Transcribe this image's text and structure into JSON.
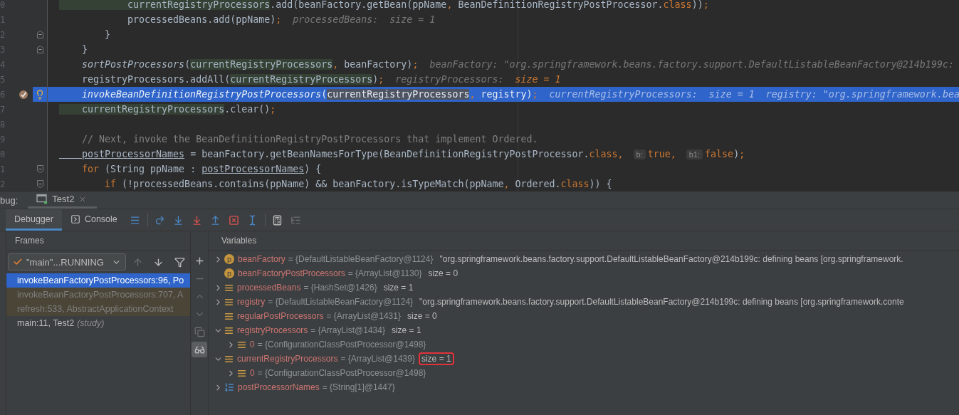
{
  "editor": {
    "lines": [
      {
        "number": "0",
        "current": false,
        "breakpoint": false,
        "bulb": false,
        "kind": "plain",
        "tokens": [
          {
            "kind": "var",
            "text": "            currentRegistryProcessors"
          },
          {
            "kind": "plain",
            "text": ".add(beanFactory.getBean(ppName"
          },
          {
            "kind": "kw",
            "text": ", "
          },
          {
            "kind": "plain",
            "text": "BeanDefinitionRegistryPostProcessor."
          },
          {
            "kind": "kw",
            "text": "class"
          },
          {
            "kind": "plain",
            "text": "))"
          },
          {
            "kind": "kw",
            "text": ";"
          }
        ]
      },
      {
        "number": "1",
        "current": false,
        "breakpoint": false,
        "bulb": false,
        "kind": "plain",
        "tokens": [
          {
            "kind": "plain",
            "text": "            processedBeans.add(ppName)"
          },
          {
            "kind": "kw",
            "text": ";"
          },
          {
            "kind": "hint",
            "text": "  processedBeans:  size = 1"
          }
        ]
      },
      {
        "number": "2",
        "current": false,
        "breakpoint": false,
        "bulb": false,
        "kind": "fold-end",
        "tokens": [
          {
            "kind": "plain",
            "text": "        }"
          }
        ]
      },
      {
        "number": "3",
        "current": false,
        "breakpoint": false,
        "bulb": false,
        "kind": "fold-end",
        "tokens": [
          {
            "kind": "plain",
            "text": "    }"
          }
        ]
      },
      {
        "number": "4",
        "current": false,
        "breakpoint": false,
        "bulb": false,
        "kind": "plain",
        "tokens": [
          {
            "kind": "method",
            "text": "    sortPostProcessors"
          },
          {
            "kind": "plain",
            "text": "("
          },
          {
            "kind": "var",
            "text": "currentRegistryProcessors"
          },
          {
            "kind": "kw",
            "text": ", "
          },
          {
            "kind": "plain",
            "text": "beanFactory)"
          },
          {
            "kind": "kw",
            "text": ";"
          },
          {
            "kind": "hint",
            "text": "  beanFactory: \"org.springframework.beans.factory.support.DefaultListableBeanFactory@214b199c:"
          }
        ]
      },
      {
        "number": "5",
        "current": false,
        "breakpoint": false,
        "bulb": false,
        "kind": "plain",
        "tokens": [
          {
            "kind": "plain",
            "text": "    registryProcessors.addAll("
          },
          {
            "kind": "var",
            "text": "currentRegistryProcessors"
          },
          {
            "kind": "plain",
            "text": ")"
          },
          {
            "kind": "kw",
            "text": ";"
          },
          {
            "kind": "hint",
            "text": "  registryProcessors:  "
          },
          {
            "kind": "hint-value",
            "text": "size = 1"
          }
        ]
      },
      {
        "number": "6",
        "current": true,
        "breakpoint": true,
        "bulb": true,
        "kind": "plain",
        "tokens": [
          {
            "kind": "method",
            "text": "    invokeBeanDefinitionRegistryPostProcessors"
          },
          {
            "kind": "plain",
            "text": "("
          },
          {
            "kind": "var",
            "text": "currentRegistryProcessors"
          },
          {
            "kind": "kw",
            "text": ", "
          },
          {
            "kind": "plain",
            "text": "registry)"
          },
          {
            "kind": "kw",
            "text": ";"
          },
          {
            "kind": "hint",
            "text": "  currentRegistryProcessors:  size = 1  registry: \"org.springframework.bea"
          }
        ]
      },
      {
        "number": "7",
        "current": false,
        "breakpoint": false,
        "bulb": false,
        "kind": "plain",
        "tokens": [
          {
            "kind": "var",
            "text": "    currentRegistryProcessors"
          },
          {
            "kind": "plain",
            "text": ".clear()"
          },
          {
            "kind": "kw",
            "text": ";"
          }
        ]
      },
      {
        "number": "8",
        "current": false,
        "breakpoint": false,
        "bulb": false,
        "kind": "plain"
      },
      {
        "number": "9",
        "current": false,
        "breakpoint": false,
        "bulb": false,
        "kind": "plain",
        "tokens": [
          {
            "kind": "comment",
            "text": "    // Next, invoke the BeanDefinitionRegistryPostProcessors that implement Ordered."
          }
        ]
      },
      {
        "number": "0",
        "current": false,
        "breakpoint": false,
        "bulb": false,
        "kind": "plain",
        "tokens": [
          {
            "kind": "field",
            "text": "    postProcessorNames"
          },
          {
            "kind": "plain",
            "text": " = beanFactory.getBeanNamesForType(BeanDefinitionRegistryPostProcessor."
          },
          {
            "kind": "kw",
            "text": "class, "
          },
          {
            "kind": "param",
            "text": "b:"
          },
          {
            "kind": "kw",
            "text": "true, "
          },
          {
            "kind": "param",
            "text": "b1:"
          },
          {
            "kind": "kw",
            "text": "false"
          },
          {
            "kind": "plain",
            "text": ")"
          },
          {
            "kind": "kw",
            "text": ";"
          }
        ]
      },
      {
        "number": "1",
        "current": false,
        "breakpoint": false,
        "bulb": false,
        "kind": "fold-start",
        "tokens": [
          {
            "kind": "kw",
            "text": "    for "
          },
          {
            "kind": "plain",
            "text": "(String ppName : "
          },
          {
            "kind": "field",
            "text": "postProcessorNames"
          },
          {
            "kind": "plain",
            "text": ") {"
          }
        ]
      },
      {
        "number": "2",
        "current": false,
        "breakpoint": false,
        "bulb": false,
        "kind": "fold-start",
        "tokens": [
          {
            "kind": "kw",
            "text": "        if "
          },
          {
            "kind": "plain",
            "text": "(!processedBeans.contains(ppName) && beanFactory.isTypeMatch(ppName"
          },
          {
            "kind": "kw",
            "text": ", "
          },
          {
            "kind": "plain",
            "text": "Ordered."
          },
          {
            "kind": "kw",
            "text": "class"
          },
          {
            "kind": "plain",
            "text": ")) {"
          }
        ]
      }
    ]
  },
  "debug": {
    "label": "bug:",
    "session": {
      "title": "Test2"
    },
    "tabs": [
      {
        "label": "Debugger",
        "kind": "plain",
        "selected": true
      },
      {
        "label": "Console",
        "kind": "console",
        "selected": false
      }
    ],
    "toolbar": [
      {
        "kind": "menu",
        "disabled": false
      },
      {
        "kind": "separator"
      },
      {
        "kind": "step-over",
        "disabled": false
      },
      {
        "kind": "step-into",
        "disabled": false
      },
      {
        "kind": "force-step-into",
        "disabled": false
      },
      {
        "kind": "step-out",
        "disabled": false
      },
      {
        "kind": "drop-frame",
        "disabled": false
      },
      {
        "kind": "run-to-cursor",
        "disabled": false
      },
      {
        "kind": "separator"
      },
      {
        "kind": "evaluate",
        "disabled": false
      },
      {
        "kind": "trace",
        "disabled": true
      }
    ],
    "frames": {
      "title": "Frames",
      "thread": "\"main\"...RUNNING",
      "nav": [
        {
          "kind": "up",
          "disabled": true
        },
        {
          "kind": "down",
          "disabled": false
        },
        {
          "kind": "filter",
          "disabled": false
        }
      ],
      "items": [
        {
          "text": "invokeBeanFactoryPostProcessors:96, Po",
          "kind": "project",
          "selected": true
        },
        {
          "text": "invokeBeanFactoryPostProcessors:707, A",
          "kind": "library",
          "selected": false
        },
        {
          "text": "refresh:533, AbstractApplicationContext",
          "kind": "library",
          "selected": false
        },
        {
          "text": "main:11, Test2",
          "package": "(study)",
          "kind": "project",
          "selected": false
        }
      ]
    },
    "side_toolbar": [
      {
        "kind": "add",
        "disabled": false
      },
      {
        "kind": "remove",
        "disabled": true
      },
      {
        "kind": "up",
        "disabled": true
      },
      {
        "kind": "down",
        "disabled": true
      },
      {
        "kind": "copy",
        "disabled": true
      },
      {
        "kind": "glasses",
        "disabled": false,
        "on": true
      }
    ],
    "variables": {
      "title": "Variables",
      "items": [
        {
          "expandable": true,
          "expanded": false,
          "kind": "param",
          "marker": "p",
          "name": "beanFactory",
          "type": "= {DefaultListableBeanFactory@1124}",
          "value": "\"org.springframework.beans.factory.support.DefaultListableBeanFactory@214b199c: defining beans [org.springframework.",
          "boxed": false
        },
        {
          "expandable": false,
          "kind": "param",
          "marker": "p",
          "name": "beanFactoryPostProcessors",
          "type": "= {ArrayList@1130}",
          "value": "size = 0",
          "boxed": false
        },
        {
          "expandable": true,
          "expanded": false,
          "kind": "field",
          "name": "processedBeans",
          "type": "= {HashSet@1426}",
          "value": "size = 1",
          "boxed": false
        },
        {
          "expandable": true,
          "expanded": false,
          "kind": "field",
          "name": "registry",
          "type": "= {DefaultListableBeanFactory@1124}",
          "value": "\"org.springframework.beans.factory.support.DefaultListableBeanFactory@214b199c: defining beans [org.springframework.conte",
          "boxed": false
        },
        {
          "expandable": false,
          "kind": "field",
          "name": "regularPostProcessors",
          "type": "= {ArrayList@1431}",
          "value": "size = 0",
          "boxed": false
        },
        {
          "expandable": true,
          "expanded": true,
          "kind": "field",
          "name": "registryProcessors",
          "type": "= {ArrayList@1434}",
          "value": "size = 1",
          "boxed": false,
          "children": [
            {
              "expandable": true,
              "expanded": false,
              "kind": "field",
              "name": "0",
              "type": "= {ConfigurationClassPostProcessor@1498}"
            }
          ]
        },
        {
          "expandable": true,
          "expanded": true,
          "kind": "field",
          "name": "currentRegistryProcessors",
          "type": "= {ArrayList@1439}",
          "value": "size = 1",
          "boxed": true,
          "children": [
            {
              "expandable": true,
              "expanded": false,
              "kind": "field",
              "name": "0",
              "type": "= {ConfigurationClassPostProcessor@1498}"
            }
          ]
        },
        {
          "expandable": true,
          "expanded": false,
          "kind": "array",
          "name": "postProcessorNames",
          "type": "= {String[1]@1447}"
        }
      ]
    }
  }
}
